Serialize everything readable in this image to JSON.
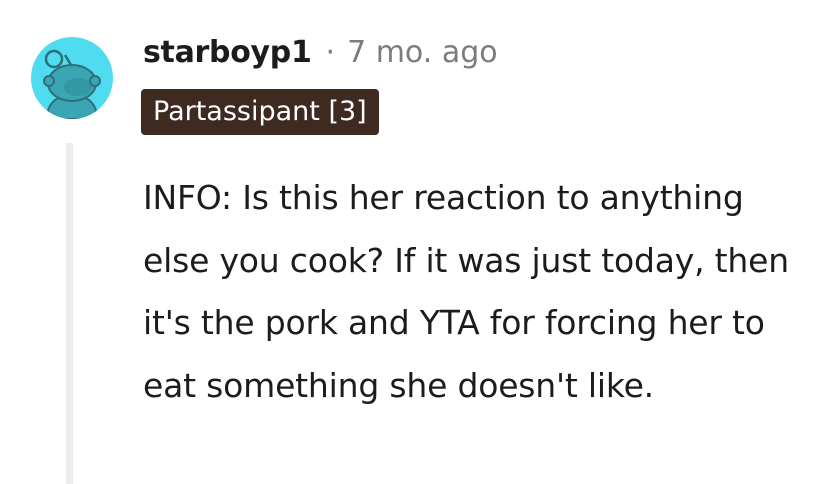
{
  "comment": {
    "author": "starboyp1",
    "separator": "·",
    "timestamp": "7 mo. ago",
    "flair": "Partassipant [3]",
    "body": "INFO: Is this her reaction to anything else you cook? If it was just today, then it's the pork and YTA for forcing her to eat something she doesn't like."
  },
  "colors": {
    "avatar_bg": "#4fdcf0",
    "flair_bg": "#3e2a20",
    "meta_text": "#7c7c7c",
    "thread_line": "#ececec"
  },
  "icons": {
    "avatar": "snoo-avatar-icon"
  }
}
